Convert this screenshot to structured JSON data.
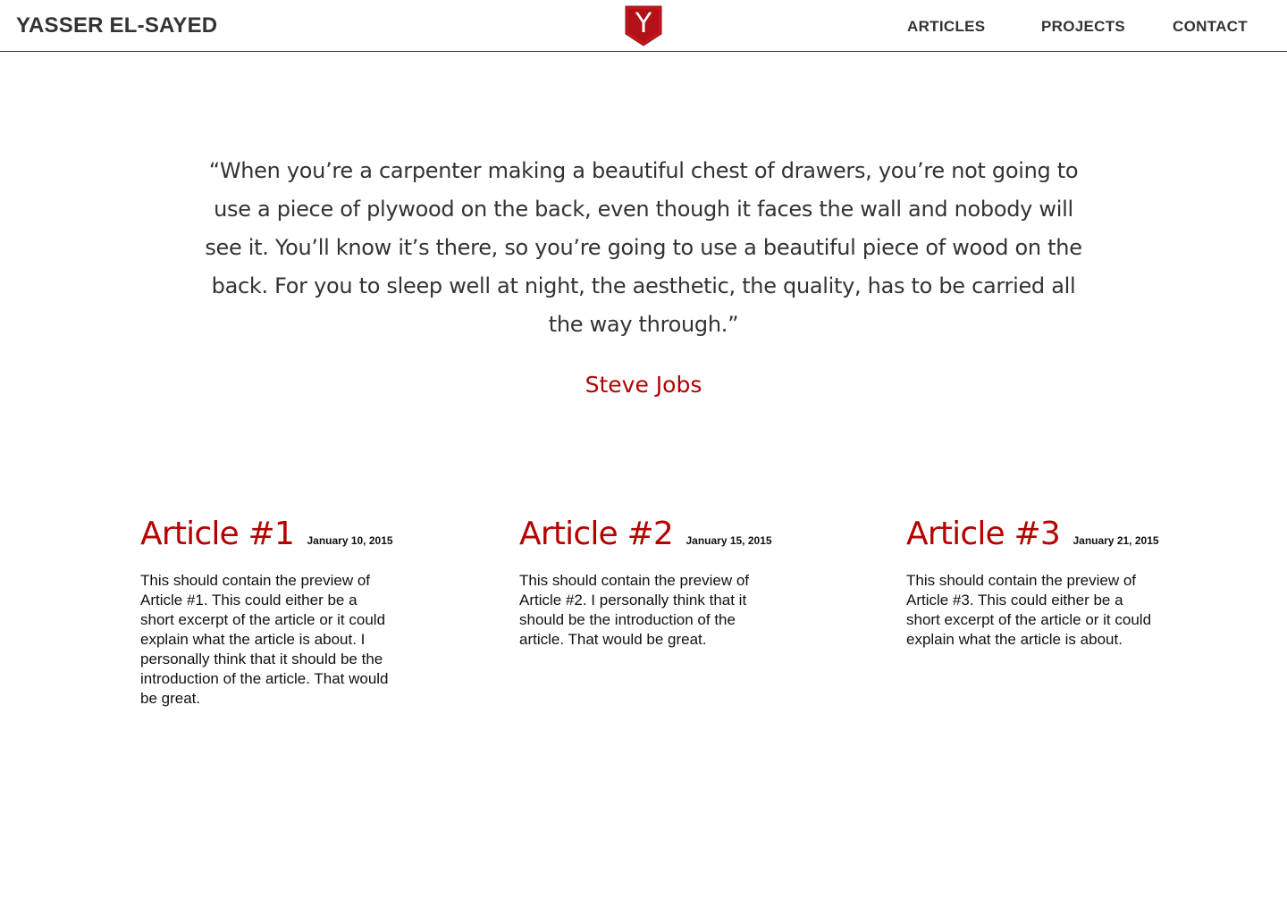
{
  "header": {
    "site_title": "YASSER EL-SAYED",
    "logo_letter": "Y",
    "nav": [
      {
        "label": "ARTICLES"
      },
      {
        "label": "PROJECTS"
      },
      {
        "label": "CONTACT"
      }
    ]
  },
  "quote": {
    "text": "“When you’re a carpenter making a beautiful chest of drawers, you’re not going to use a piece of plywood on the back, even though it faces the wall and nobody will see it. You’ll know it’s there, so you’re going to use a beautiful piece of wood on the back. For you to sleep well at night, the aesthetic, the quality, has to be carried all the way through.”",
    "author": "Steve Jobs"
  },
  "articles": [
    {
      "title": "Article #1",
      "date": "January 10, 2015",
      "preview": "This should contain the preview of Article #1. This could either be a short excerpt of the article or it could explain what the article is about. I personally think that it should be the introduction of the article. That would be great."
    },
    {
      "title": "Article #2",
      "date": "January 15, 2015",
      "preview": "This should contain the preview of Article #2. I personally think that it should be the introduction of the article. That would be great."
    },
    {
      "title": "Article #3",
      "date": "January 21, 2015",
      "preview": "This should contain the preview of Article #3. This could either be a short excerpt of the article or it could explain what the article is about."
    }
  ],
  "colors": {
    "accent": "#b50000",
    "text": "#333333",
    "logo_red": "#c8161d"
  }
}
